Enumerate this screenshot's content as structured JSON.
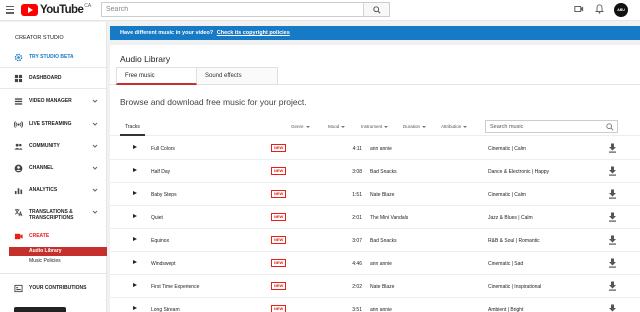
{
  "header": {
    "logo_text": "YouTube",
    "logo_region": "CA",
    "search_placeholder": "Search",
    "avatar_label": "ABU"
  },
  "sidebar": {
    "title": "CREATOR STUDIO",
    "items": [
      {
        "label": "TRY STUDIO BETA",
        "icon": "gear-icon"
      },
      {
        "label": "DASHBOARD",
        "icon": "dashboard-icon"
      },
      {
        "label": "VIDEO MANAGER",
        "icon": "video-manager-icon"
      },
      {
        "label": "LIVE STREAMING",
        "icon": "live-icon"
      },
      {
        "label": "COMMUNITY",
        "icon": "community-icon"
      },
      {
        "label": "CHANNEL",
        "icon": "channel-icon"
      },
      {
        "label": "ANALYTICS",
        "icon": "analytics-icon"
      },
      {
        "label": "TRANSLATIONS & TRANSCRIPTIONS",
        "icon": "translate-icon"
      },
      {
        "label": "CREATE",
        "icon": "create-icon"
      }
    ],
    "create_sub": [
      "Audio Library",
      "Music Policies"
    ],
    "contributions": "YOUR CONTRIBUTIONS"
  },
  "banner": {
    "text": "Have different music in your video?",
    "link": "Check its copyright policies"
  },
  "library": {
    "title": "Audio Library",
    "tabs": [
      "Free music",
      "Sound effects"
    ],
    "subtitle": "Browse and download free music for your project.",
    "columns": {
      "tracks": "Tracks",
      "genre": "Genre",
      "mood": "Mood",
      "instrument": "Instrument",
      "duration": "Duration",
      "attribution": "Attribution"
    },
    "search_placeholder": "Search music",
    "new_badge": "NEW",
    "tracks": [
      {
        "title": "Full Colors",
        "duration": "4:11",
        "artist": "ann annie",
        "genre": "Cinematic | Calm"
      },
      {
        "title": "Half Day",
        "duration": "3:08",
        "artist": "Bad Snacks",
        "genre": "Dance & Electronic | Happy"
      },
      {
        "title": "Baby Steps",
        "duration": "1:51",
        "artist": "Nate Blaze",
        "genre": "Cinematic | Calm"
      },
      {
        "title": "Quiet",
        "duration": "2:01",
        "artist": "The Mini Vandals",
        "genre": "Jazz & Blues | Calm"
      },
      {
        "title": "Equinox",
        "duration": "3:07",
        "artist": "Bad Snacks",
        "genre": "R&B & Soul | Romantic"
      },
      {
        "title": "Windswept",
        "duration": "4:46",
        "artist": "ann annie",
        "genre": "Cinematic | Sad"
      },
      {
        "title": "First Time Experience",
        "duration": "2:02",
        "artist": "Nate Blaze",
        "genre": "Cinematic | Inspirational"
      },
      {
        "title": "Long Stream",
        "duration": "3:51",
        "artist": "ann annie",
        "genre": "Ambient | Bright"
      }
    ]
  },
  "colors": {
    "brand_red": "#ff0000",
    "accent_red": "#c4302b",
    "banner_blue": "#167ac6"
  }
}
